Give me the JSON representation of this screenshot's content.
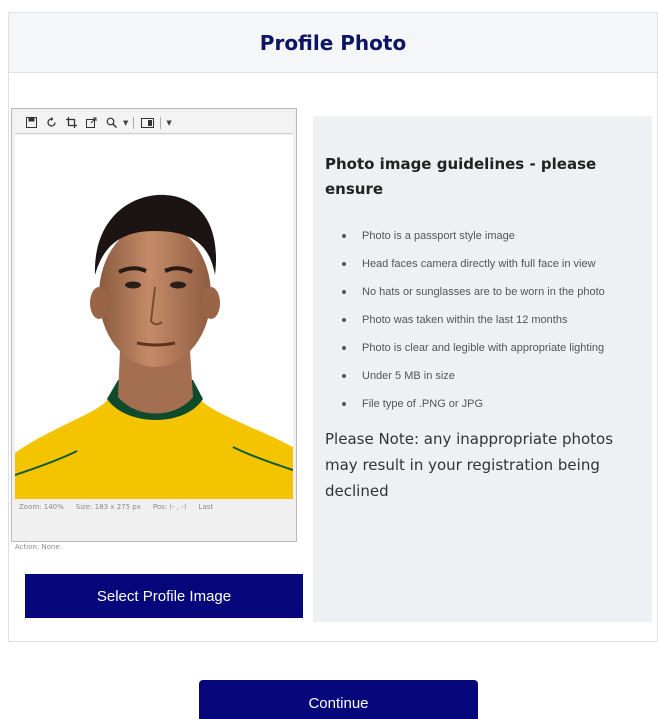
{
  "header": {
    "title": "Profile Photo"
  },
  "editor": {
    "toolbar_icons": [
      "save-icon",
      "rotate-icon",
      "crop-icon",
      "resize-icon",
      "zoom-icon",
      "dropdown-icon",
      "view-icon",
      "dropdown-icon"
    ],
    "status": {
      "zoom": "Zoom: 140%",
      "size": "Size: 183 x 275 px",
      "pos": "Pos: (- , -)",
      "last": "Last"
    },
    "action": "Action: None"
  },
  "select_button": {
    "label": "Select Profile Image"
  },
  "guidelines": {
    "title": "Photo image guidelines - please ensure",
    "items": [
      "Photo is a passport style image",
      "Head faces camera directly with full face in view",
      "No hats or sunglasses are to be worn in the photo",
      "Photo was taken within the last 12 months",
      "Photo is clear and legible with appropriate lighting",
      "Under 5 MB in size",
      "File type of .PNG or JPG"
    ],
    "note": "Please Note: any inappropriate photos may result in your registration being declined"
  },
  "continue_button": {
    "label": "Continue"
  },
  "colors": {
    "brand": "#06077a",
    "title": "#0c1463",
    "panel": "#eef0f4",
    "jersey": "#f5c400"
  }
}
